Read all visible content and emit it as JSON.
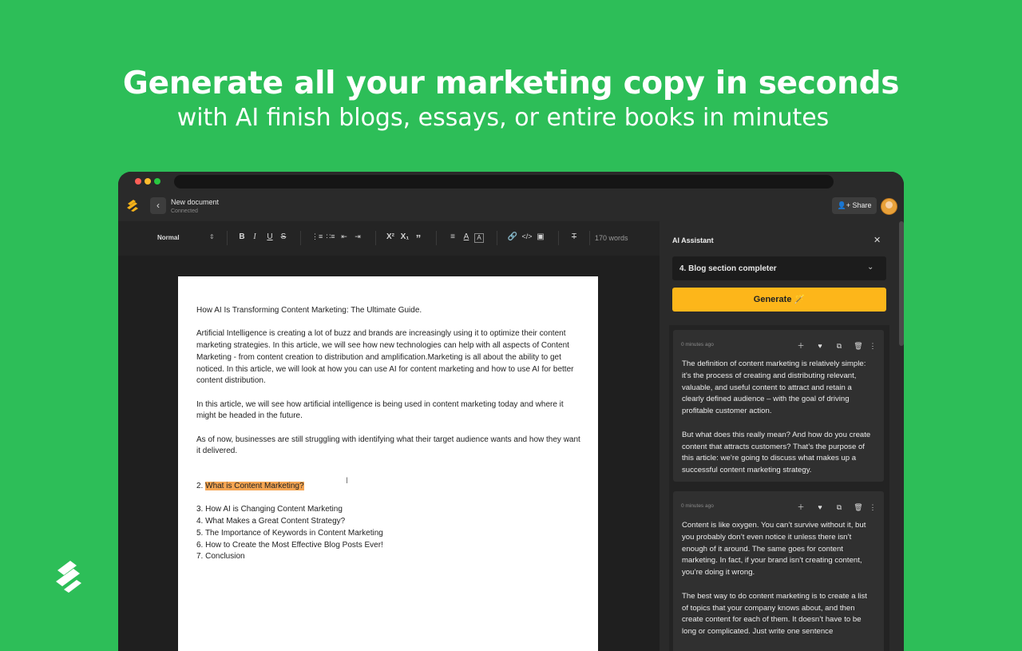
{
  "hero": {
    "title": "Generate all your marketing copy in seconds",
    "subtitle": "with AI finish blogs, essays, or entire books in minutes"
  },
  "appbar": {
    "back_icon": "chevron-left-icon",
    "doc_title": "New document",
    "doc_status": "Connected",
    "share_label": "Share"
  },
  "toolbar": {
    "style_select": "Normal",
    "word_count": "170 words",
    "icons": [
      "bold",
      "italic",
      "underline",
      "strikethrough",
      "ordered-list",
      "bullet-list",
      "outdent",
      "indent",
      "superscript",
      "subscript",
      "quote",
      "align",
      "font-color",
      "highlight",
      "link",
      "code",
      "image",
      "clear-format"
    ]
  },
  "document": {
    "title_line": "How AI Is Transforming Content Marketing: The Ultimate Guide.",
    "para1": "Artificial Intelligence is creating a lot of buzz and brands are increasingly using it to optimize their content marketing strategies. In this article, we will see how new technologies can help with all aspects of Content Marketing - from content creation to distribution and amplification.Marketing is all about the ability to get noticed. In this article, we will look at how you can use AI for content marketing and how to use AI for better content distribution.",
    "para2": "In this article, we will see how artificial intelligence is being used in content marketing today and where it might be headed in the future.",
    "para3": "As of now, businesses are still struggling with identifying what their target audience wants and how they want it delivered.",
    "item2_prefix": "2. ",
    "item2_highlight": "What is Content Marketing?",
    "items": [
      "3. How AI is Changing Content Marketing",
      "4. What Makes a Great Content Strategy?",
      "5. The Importance of Keywords in Content Marketing",
      "6. How to Create the Most Effective Blog Posts Ever!",
      "7. Conclusion"
    ]
  },
  "assistant": {
    "title": "AI Assistant",
    "template_select": "4. Blog section completer",
    "generate_label": "Generate",
    "results": [
      {
        "time": "0 minutes ago",
        "paragraphs": [
          "The definition of content marketing is relatively simple: it’s the process of creating and distributing relevant, valuable, and useful content to attract and retain a clearly defined audience – with the goal of driving profitable customer action.",
          "But what does this really mean? And how do you create content that attracts customers? That’s the purpose of this article: we’re going to discuss what makes up a successful content marketing strategy."
        ]
      },
      {
        "time": "0 minutes ago",
        "paragraphs": [
          "Content is like oxygen. You can’t survive without it, but you probably don’t even notice it unless there isn’t enough of it around. The same goes for content marketing. In fact, if your brand isn’t creating content, you’re doing it wrong.",
          "The best way to do content marketing is to create a list of topics that your company knows about, and then create content for each of them. It doesn’t have to be long or complicated. Just write one sentence"
        ]
      }
    ]
  },
  "colors": {
    "background": "#2dbe58",
    "accent": "#fdb61a",
    "highlight": "#f5a552"
  }
}
